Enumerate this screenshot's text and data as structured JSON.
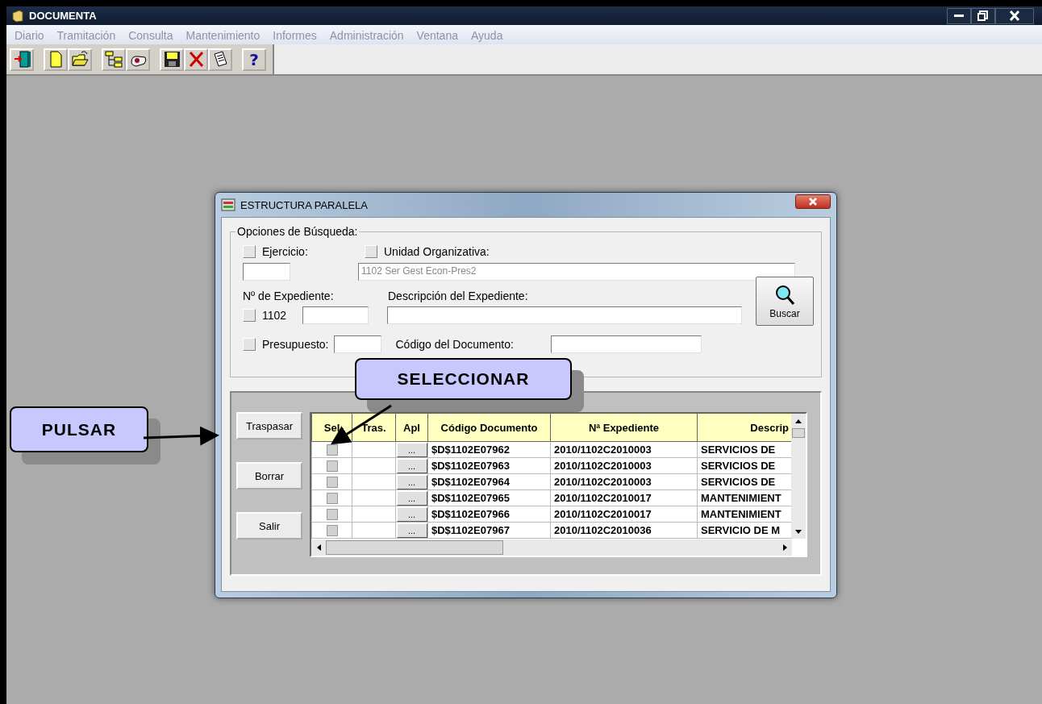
{
  "window": {
    "title": "DOCUMENTA",
    "controls": [
      {
        "kind": "minimize"
      },
      {
        "kind": "restore"
      },
      {
        "kind": "close"
      }
    ]
  },
  "menu": [
    {
      "label": "Diario",
      "disabled": true
    },
    {
      "label": "Tramitación",
      "disabled": true
    },
    {
      "label": "Consulta",
      "disabled": true
    },
    {
      "label": "Mantenimiento",
      "disabled": true
    },
    {
      "label": "Informes",
      "disabled": true
    },
    {
      "label": "Administración",
      "disabled": true
    },
    {
      "label": "Ventana",
      "disabled": true
    },
    {
      "label": "Ayuda",
      "disabled": true
    }
  ],
  "toolbar": [
    [
      {
        "kind": "exit"
      }
    ],
    [
      {
        "kind": "new"
      },
      {
        "kind": "open"
      }
    ],
    [
      {
        "kind": "tree"
      },
      {
        "kind": "preview"
      }
    ],
    [
      {
        "kind": "save"
      },
      {
        "kind": "delete"
      },
      {
        "kind": "edit"
      }
    ],
    [
      {
        "kind": "help",
        "label": "?"
      }
    ]
  ],
  "dialog": {
    "title": "ESTRUCTURA PARALELA",
    "search": {
      "legend": "Opciones de Búsqueda:",
      "ejercicio": {
        "label": "Ejercicio:",
        "checked": false
      },
      "unidad": {
        "label": "Unidad Organizativa:",
        "checked": false,
        "value": "1102  Ser Gest Econ-Pres2",
        "disabled": true
      },
      "expediente_label": "Nº de Expediente:",
      "expediente": {
        "checked": false,
        "prefix": "1102"
      },
      "descripcion_label": "Descripción del Expediente:",
      "presupuesto": {
        "label": "Presupuesto:",
        "checked": false
      },
      "codigo_label": "Código del Documento:",
      "search_button": "Buscar"
    },
    "actions": [
      "Traspasar",
      "Borrar",
      "Salir"
    ],
    "table": {
      "columns": [
        "Sel",
        "Tras.",
        "Apl",
        "Código Documento",
        "Nª Expediente",
        "Descrip"
      ],
      "rows": [
        {
          "checked": false,
          "apl": "...",
          "codigo": "$D$1102E07962",
          "expediente": "2010/1102C2010003",
          "descripcion": "SERVICIOS DE"
        },
        {
          "checked": false,
          "apl": "...",
          "codigo": "$D$1102E07963",
          "expediente": "2010/1102C2010003",
          "descripcion": "SERVICIOS DE"
        },
        {
          "checked": false,
          "apl": "...",
          "codigo": "$D$1102E07964",
          "expediente": "2010/1102C2010003",
          "descripcion": "SERVICIOS DE"
        },
        {
          "checked": false,
          "apl": "...",
          "codigo": "$D$1102E07965",
          "expediente": "2010/1102C2010017",
          "descripcion": "MANTENIMIENT"
        },
        {
          "checked": false,
          "apl": "...",
          "codigo": "$D$1102E07966",
          "expediente": "2010/1102C2010017",
          "descripcion": "MANTENIMIENT"
        },
        {
          "checked": false,
          "apl": "...",
          "codigo": "$D$1102E07967",
          "expediente": "2010/1102C2010036",
          "descripcion": "SERVICIO DE M"
        }
      ]
    }
  },
  "callouts": [
    {
      "text": "PULSAR"
    },
    {
      "text": "SELECCIONAR"
    }
  ]
}
